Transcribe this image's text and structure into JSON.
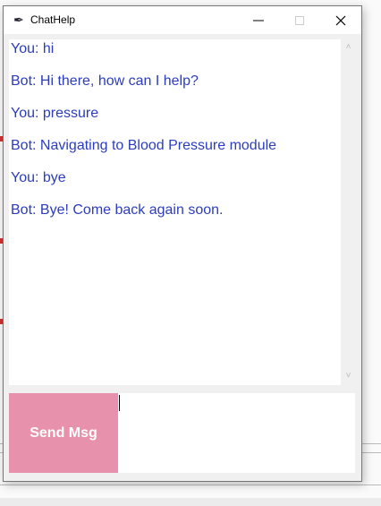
{
  "window": {
    "title": "ChatHelp"
  },
  "chat": {
    "messages": [
      "You: hi",
      "Bot: Hi there, how can I help?",
      "You: pressure",
      "Bot: Navigating to Blood Pressure module",
      "You: bye",
      "Bot: Bye! Come back again soon."
    ]
  },
  "input": {
    "value": "",
    "send_label": "Send Msg"
  },
  "colors": {
    "message_text": "#2b3dbd",
    "send_button": "#e891ad"
  }
}
